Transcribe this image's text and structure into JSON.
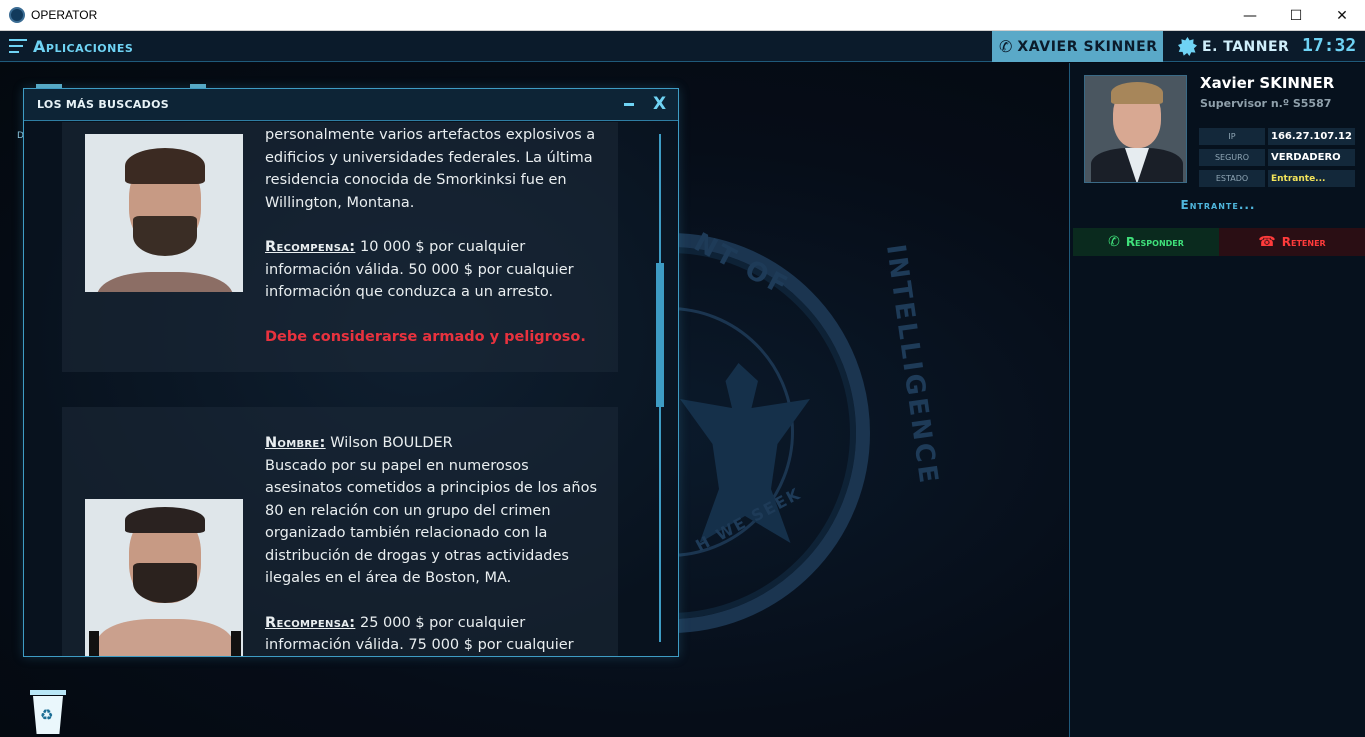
{
  "window": {
    "title": "OPERATOR",
    "minimize": "—",
    "maximize": "☐",
    "close": "✕"
  },
  "topbar": {
    "apps_label": "Aplicaciones",
    "caller_tab": "XAVIER SKINNER",
    "agent_name": "E. TANNER",
    "clock": "17:32"
  },
  "desktop": {
    "side_label": "D"
  },
  "wanted_window": {
    "title": "LOS MÁS BUSCADOS",
    "minimize": "–",
    "close": "X",
    "entries": [
      {
        "description": "personalmente varios artefactos explosivos a edificios y universidades federales. La última residencia conocida de Smorkinksi fue en Willington, Montana.",
        "reward_label": "Recompensa:",
        "reward_text": " 10 000 $ por cualquier información válida. 50 000 $ por cualquier información que conduzca a un arresto.",
        "warning": "Debe considerarse armado y peligroso."
      },
      {
        "name_label": "Nombre:",
        "name": " Wilson BOULDER",
        "description": "Buscado por su papel en numerosos asesinatos cometidos a principios de los años 80 en relación con un grupo del crimen organizado también relacionado con la distribución de drogas y otras actividades ilegales en el área de Boston, MA.",
        "reward_label": "Recompensa:",
        "reward_text": " 25 000 $ por cualquier información válida. 75 000 $ por cualquier"
      }
    ]
  },
  "caller_panel": {
    "name": "Xavier SKINNER",
    "role": "Supervisor n.º S5587",
    "info": [
      {
        "key": "IP",
        "value": "166.27.107.12"
      },
      {
        "key": "SEGURO",
        "value": "VERDADERO"
      },
      {
        "key": "ESTADO",
        "value": "Entrante..."
      }
    ],
    "status": "Entrante...",
    "answer_label": "Responder",
    "hold_label": "Retener"
  },
  "colors": {
    "accent": "#6fd3f4",
    "answer": "#3fe07a",
    "hold": "#ff3b3b",
    "warning": "#e8323e"
  },
  "icons": {
    "app": "agency-seal-icon",
    "apps_menu": "hamburger-icon",
    "caller": "phone-icon",
    "agent": "badge-icon",
    "recycle": "recycle-bin-icon"
  }
}
